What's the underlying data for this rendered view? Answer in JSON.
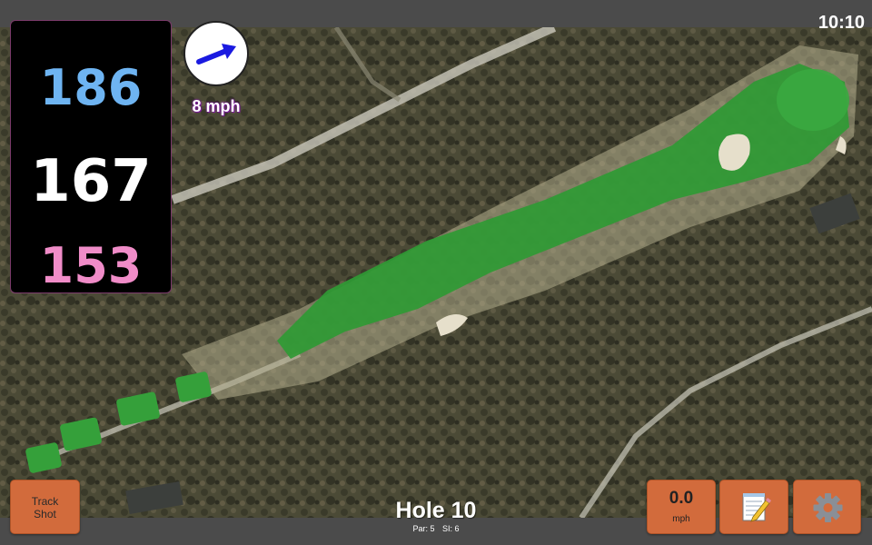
{
  "status_bar": {
    "time": "10:10"
  },
  "distances": {
    "back": "186",
    "center": "167",
    "front": "153"
  },
  "wind": {
    "speed": "8 mph",
    "direction_icon": "arrow-icon",
    "arrow_color": "#1a1ae0"
  },
  "track_shot": {
    "label_line1": "Track",
    "label_line2": "Shot"
  },
  "hole": {
    "title": "Hole 10",
    "par": "Par: 5",
    "si": "SI: 6"
  },
  "speed_display": {
    "value": "0.0",
    "unit": "mph"
  },
  "toolbar": {
    "notes_icon": "notepad-icon",
    "settings_icon": "gear-icon"
  },
  "colors": {
    "button": "#d26b3c",
    "back_distance": "#6eb4f2",
    "center_distance": "#ffffff",
    "front_distance": "#f08cc8",
    "bar": "#4b4b4b"
  }
}
